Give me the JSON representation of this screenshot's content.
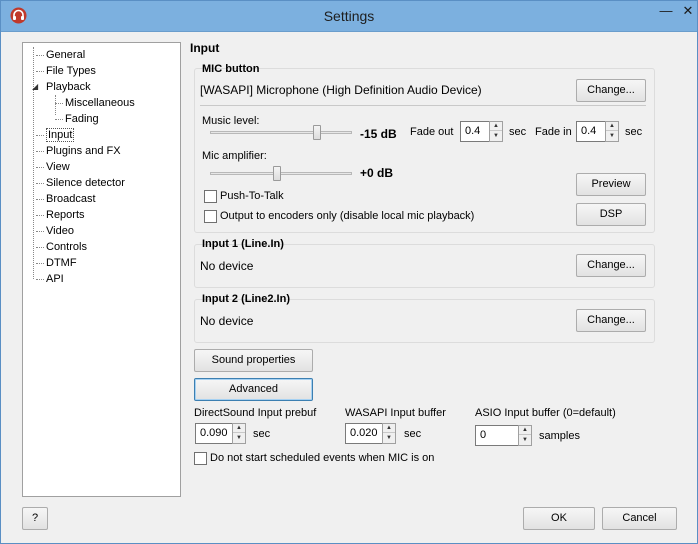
{
  "window": {
    "title": "Settings"
  },
  "tree": {
    "items": [
      "General",
      "File Types",
      "Playback",
      "Miscellaneous",
      "Fading",
      "Input",
      "Plugins and FX",
      "View",
      "Silence detector",
      "Broadcast",
      "Reports",
      "Video",
      "Controls",
      "DTMF",
      "API"
    ],
    "selected": "Input"
  },
  "page": {
    "heading": "Input"
  },
  "mic": {
    "group_title": "MIC button",
    "device": "[WASAPI] Microphone (High Definition Audio Device)",
    "change_label": "Change...",
    "music_level_label": "Music level:",
    "music_level_value": "-15 dB",
    "music_level_fraction": 0.77,
    "mic_amp_label": "Mic amplifier:",
    "mic_amp_value": "+0 dB",
    "mic_amp_fraction": 0.47,
    "fade_out_label": "Fade out",
    "fade_out_value": "0.4",
    "fade_in_label": "Fade in",
    "fade_in_value": "0.4",
    "sec": "sec",
    "push_to_talk": "Push-To-Talk",
    "output_encoders_only": "Output to encoders only (disable local mic playback)",
    "preview_label": "Preview",
    "dsp_label": "DSP"
  },
  "input1": {
    "title": "Input 1 (Line.In)",
    "device": "No device",
    "change_label": "Change..."
  },
  "input2": {
    "title": "Input 2 (Line2.In)",
    "device": "No device",
    "change_label": "Change..."
  },
  "buttons": {
    "sound_properties": "Sound properties",
    "advanced": "Advanced"
  },
  "buffers": {
    "directsound_label": "DirectSound Input prebuf",
    "directsound_value": "0.090",
    "wasapi_label": "WASAPI Input buffer",
    "wasapi_value": "0.020",
    "asio_label": "ASIO Input buffer (0=default)",
    "asio_value": "0",
    "sec": "sec",
    "samples": "samples"
  },
  "no_scheduled": "Do not start scheduled events when MIC is on",
  "footer": {
    "help": "?",
    "ok": "OK",
    "cancel": "Cancel"
  }
}
